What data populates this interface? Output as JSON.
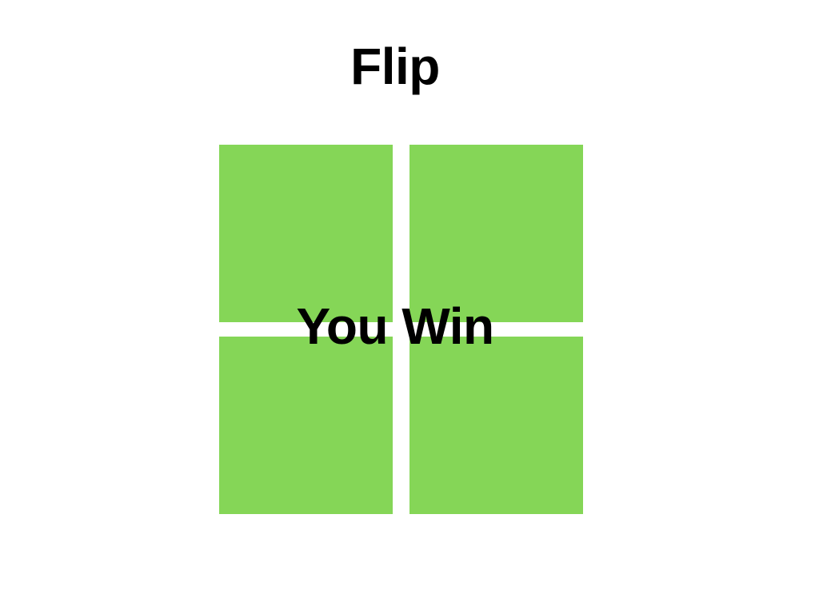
{
  "game": {
    "title": "Flip",
    "status_message": "You Win"
  },
  "board": {
    "rows": 2,
    "cols": 2,
    "tile_color": "#85d657",
    "tiles": [
      {
        "state": "flipped"
      },
      {
        "state": "flipped"
      },
      {
        "state": "flipped"
      },
      {
        "state": "flipped"
      }
    ]
  }
}
